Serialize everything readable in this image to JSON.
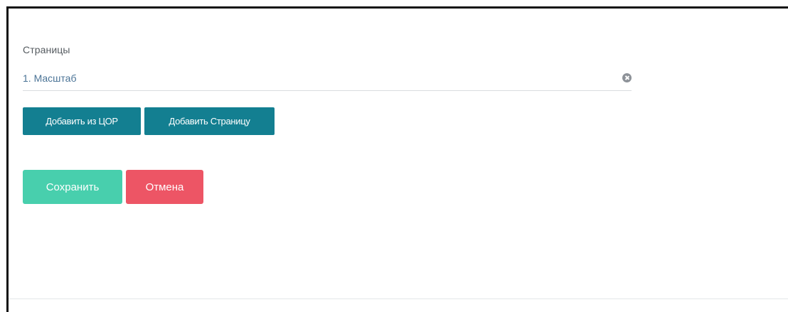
{
  "pages_section": {
    "label": "Страницы",
    "items": [
      {
        "title": "1. Масштаб"
      }
    ]
  },
  "actions": {
    "add_from_cor_label": "Добавить из ЦОР",
    "add_page_label": "Добавить Страницу"
  },
  "form": {
    "save_label": "Сохранить",
    "cancel_label": "Отмена"
  },
  "colors": {
    "primary_teal": "#137f91",
    "save_green": "#48cfad",
    "cancel_red": "#ed5565",
    "link_blue": "#4a7396"
  },
  "icons": {
    "remove": "circle-x-icon"
  }
}
